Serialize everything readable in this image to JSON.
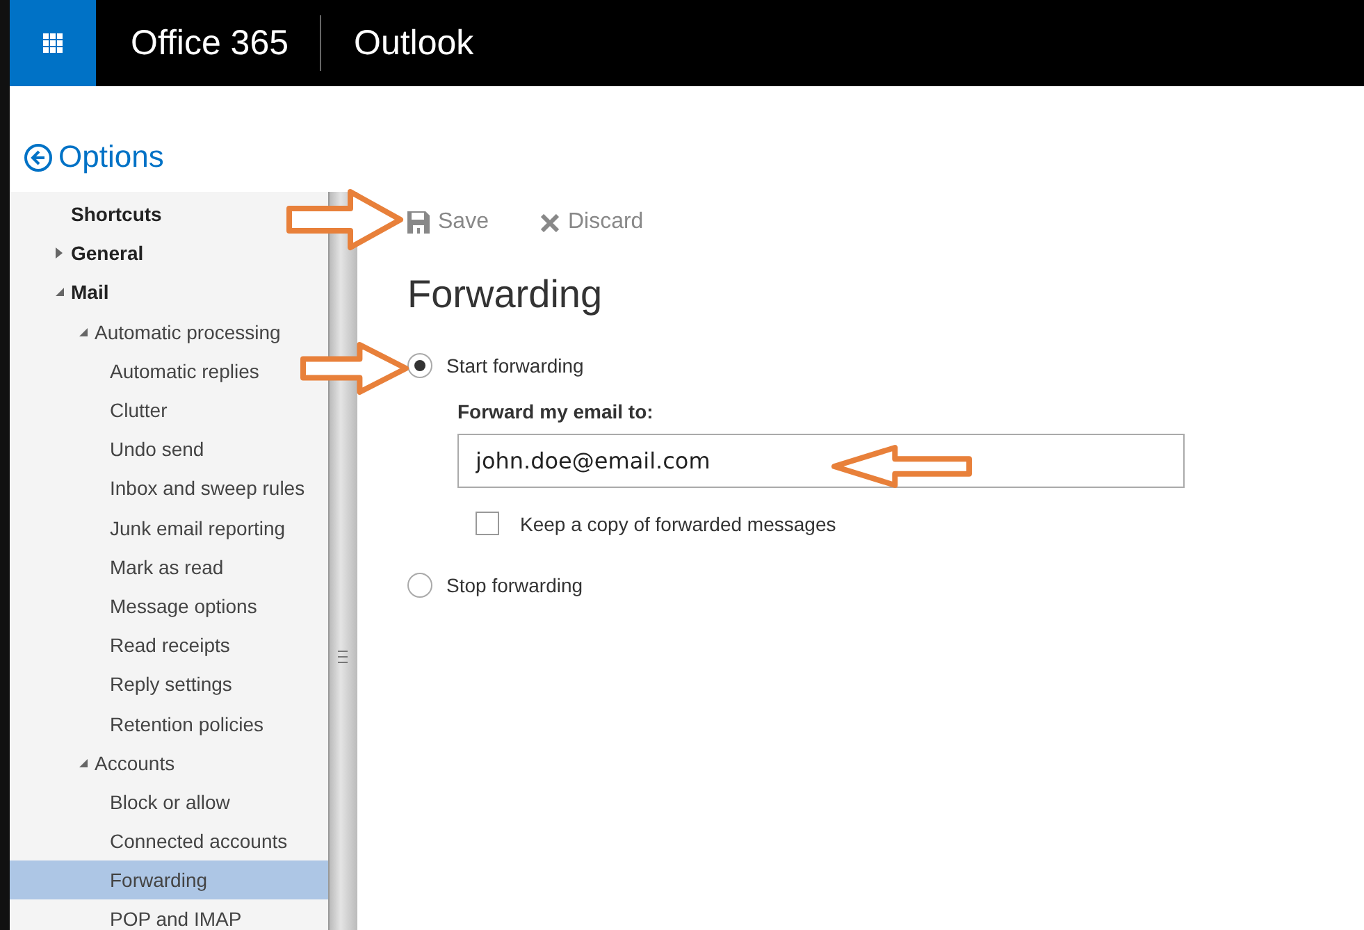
{
  "top_bar": {
    "brand": "Office 365",
    "app": "Outlook"
  },
  "sidebar": {
    "title": "Options",
    "items": [
      {
        "label": "Shortcuts",
        "selected": false
      },
      {
        "label": "General",
        "selected": false,
        "expanded": false
      },
      {
        "label": "Mail",
        "selected": false,
        "expanded": true,
        "children": [
          {
            "label": "Automatic processing",
            "selected": false,
            "expanded": true,
            "children": [
              {
                "label": "Automatic replies",
                "selected": false
              },
              {
                "label": "Clutter",
                "selected": false
              },
              {
                "label": "Undo send",
                "selected": false
              },
              {
                "label": "Inbox and sweep rules",
                "selected": false
              },
              {
                "label": "Junk email reporting",
                "selected": false
              },
              {
                "label": "Mark as read",
                "selected": false
              },
              {
                "label": "Message options",
                "selected": false
              },
              {
                "label": "Read receipts",
                "selected": false
              },
              {
                "label": "Reply settings",
                "selected": false
              },
              {
                "label": "Retention policies",
                "selected": false
              }
            ]
          },
          {
            "label": "Accounts",
            "selected": false,
            "expanded": true,
            "children": [
              {
                "label": "Block or allow",
                "selected": false
              },
              {
                "label": "Connected accounts",
                "selected": false
              },
              {
                "label": "Forwarding",
                "selected": true
              },
              {
                "label": "POP and IMAP",
                "selected": false
              }
            ]
          }
        ]
      }
    ]
  },
  "toolbar": {
    "buttons": [
      {
        "label": "Save",
        "kind": "save"
      },
      {
        "label": "Discard",
        "kind": "discard"
      }
    ]
  },
  "content": {
    "heading": "Forwarding",
    "options": [
      {
        "label": "Start forwarding",
        "selected": true
      },
      {
        "label": "Stop forwarding",
        "selected": false
      }
    ],
    "field_label": "Forward my email to:",
    "email": "john.doe@email.com",
    "keep_copy": {
      "label": "Keep a copy of forwarded messages",
      "checked": false
    }
  }
}
